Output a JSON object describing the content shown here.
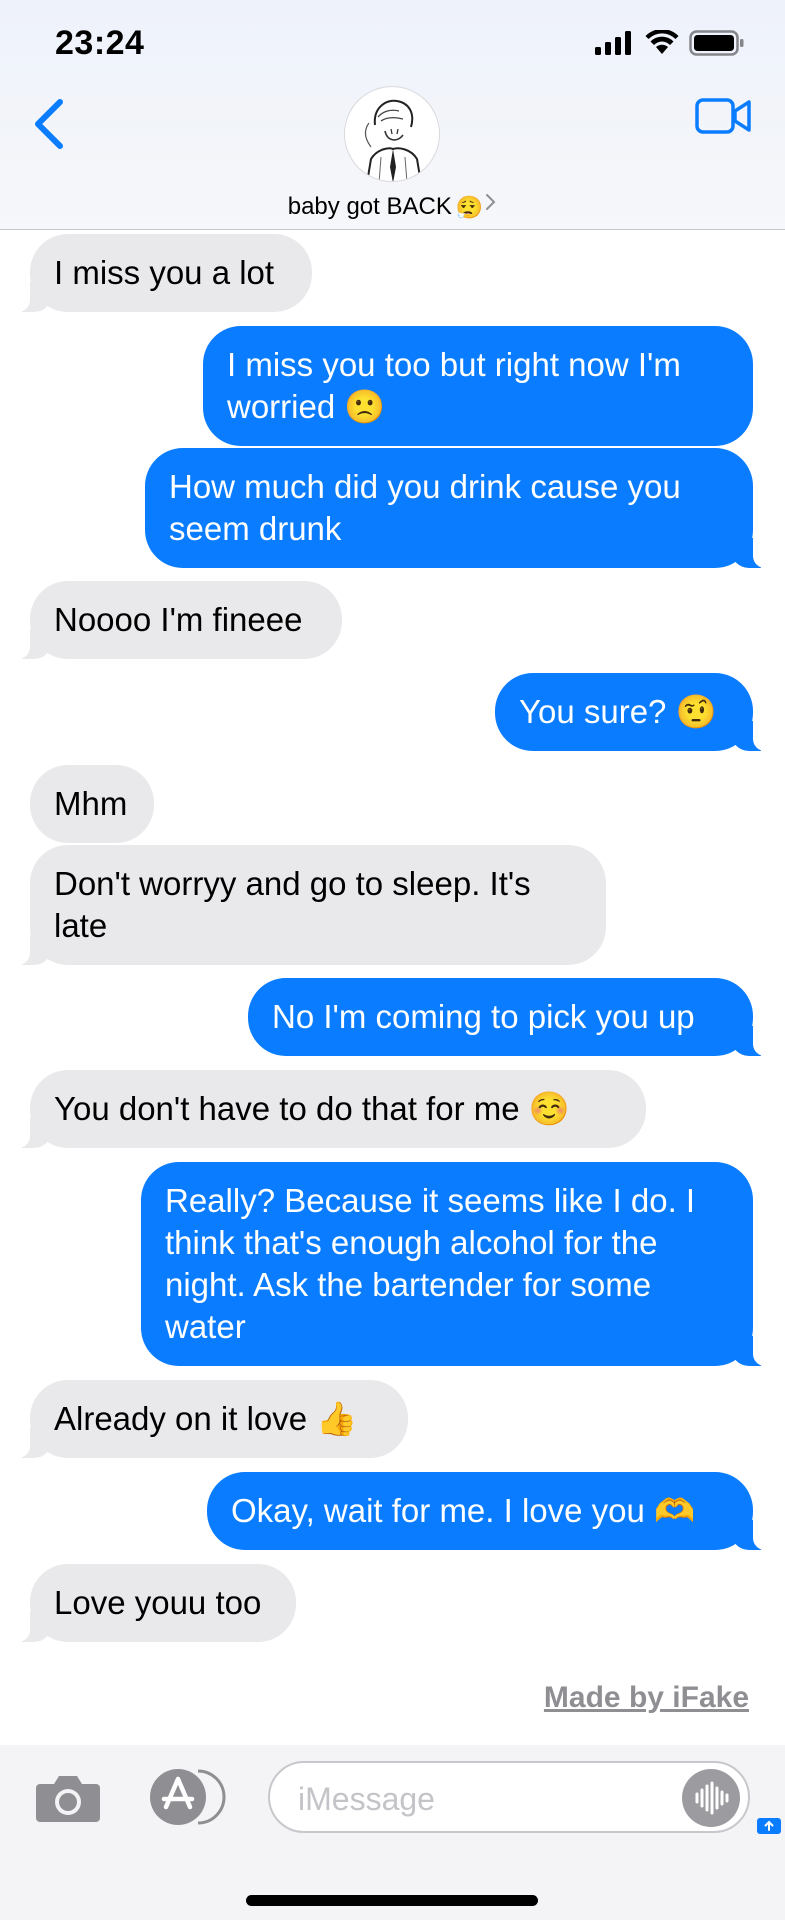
{
  "status_bar": {
    "time": "23:24"
  },
  "header": {
    "contact_name": "baby got BACK",
    "contact_emoji": "😮‍💨",
    "icons": {
      "back": "chevron-left-icon",
      "video": "video-camera-icon",
      "avatar": "contact-avatar-sketch"
    }
  },
  "messages": [
    {
      "from": "them",
      "text": "I miss you a lot"
    },
    {
      "from": "me",
      "text": "I miss you too but right now I'm worried 🙁"
    },
    {
      "from": "me",
      "text": "How much did you drink cause you seem drunk"
    },
    {
      "from": "them",
      "text": "Noooo I'm fineee"
    },
    {
      "from": "me",
      "text": "You sure? 🤨"
    },
    {
      "from": "them",
      "text": "Mhm"
    },
    {
      "from": "them",
      "text": "Don't worryy and go to sleep. It's late"
    },
    {
      "from": "me",
      "text": "No I'm coming to pick you up"
    },
    {
      "from": "them",
      "text": "You don't have to do that for me ☺️"
    },
    {
      "from": "me",
      "text": "Really? Because it seems like I do. I think that's enough alcohol for the night. Ask the bartender for some water"
    },
    {
      "from": "them",
      "text": "Already on it love 👍"
    },
    {
      "from": "me",
      "text": "Okay, wait for me. I love you 🫶"
    },
    {
      "from": "them",
      "text": "Love youu too"
    }
  ],
  "watermark": "Made by iFake",
  "input": {
    "placeholder": "iMessage",
    "icons": {
      "camera": "camera-icon",
      "apps": "app-store-icon",
      "audio": "audio-waveform-icon"
    }
  },
  "colors": {
    "sent_bubble": "#0a7cff",
    "received_bubble": "#e9e9eb",
    "accent": "#0a7cff"
  }
}
